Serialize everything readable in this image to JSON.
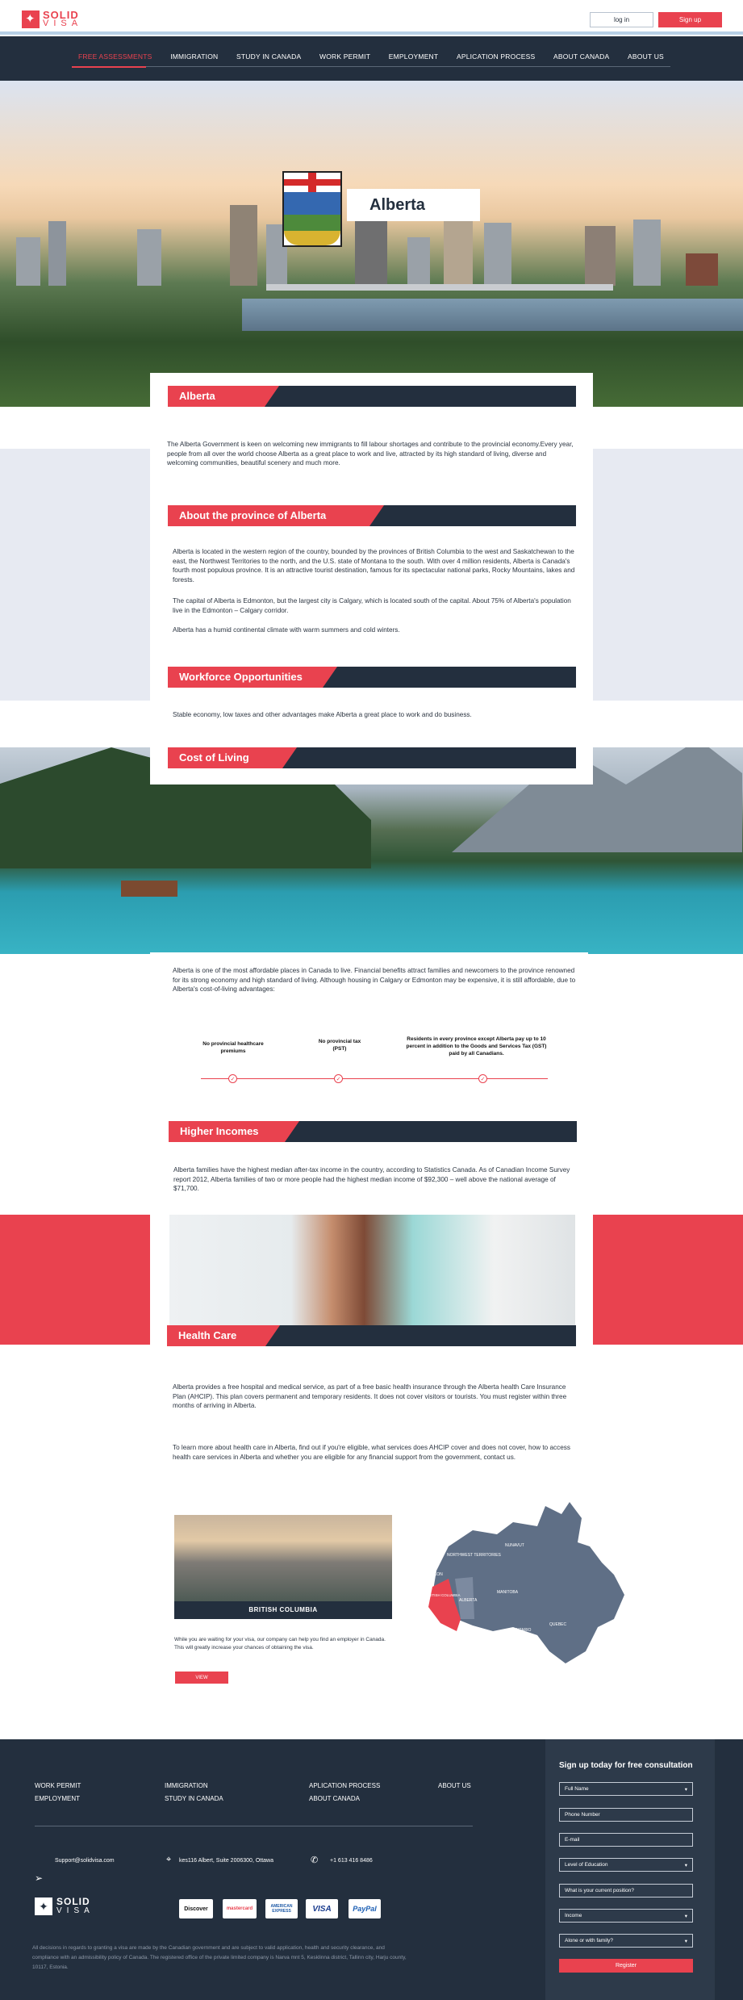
{
  "header": {
    "logo_top": "SOLID",
    "logo_bottom": "VISA",
    "login_label": "log in",
    "signup_label": "Sign up"
  },
  "nav": {
    "items": [
      {
        "label": "FREE ASSESSMENTS"
      },
      {
        "label": "IMMIGRATION"
      },
      {
        "label": "STUDY IN CANADA"
      },
      {
        "label": "WORK PERMIT"
      },
      {
        "label": "EMPLOYMENT"
      },
      {
        "label": "APLICATION PROCESS"
      },
      {
        "label": "ABOUT CANADA"
      },
      {
        "label": "ABOUT US"
      }
    ]
  },
  "hero": {
    "title": "Alberta"
  },
  "sections": {
    "alberta": {
      "title": "Alberta",
      "text": "The Alberta Government is keen on welcoming new immigrants to fill labour shortages and contribute to the provincial economy.Every year, people from all over the world choose Alberta as a great place to work and live, attracted by its high standard of living, diverse and welcoming communities, beautiful scenery and much more."
    },
    "about": {
      "title": "About the province of Alberta",
      "p1": "Alberta is located in the western region of the country, bounded by the provinces of British Columbia to the west and Saskatchewan to the east, the Northwest Territories to the north, and the U.S. state of Montana to the south. With over 4 million residents, Alberta is Canada's fourth most populous province. It is an attractive tourist destination, famous for its spectacular national parks, Rocky Mountains, lakes and forests.",
      "p2": "The capital of Alberta is Edmonton, but the largest city is Calgary, which is located south of the capital. About 75% of Alberta's population live in the Edmonton – Calgary corridor.",
      "p3": "Alberta has a humid continental climate with warm summers and cold winters."
    },
    "workforce": {
      "title": "Workforce Opportunities",
      "text": "Stable economy, low taxes and other advantages make Alberta a great place to work and do business."
    },
    "cost": {
      "title": "Cost of Living",
      "text": "Alberta is one of the most affordable places in Canada to live. Financial benefits attract families and newcomers to the province renowned for its strong economy and high standard of living. Although housing in Calgary or Edmonton may be expensive, it is still affordable, due to Alberta's cost-of-living advantages:",
      "advantages": [
        "No provincial healthcare premiums",
        "No provincial tax (PST)",
        "Residents in every province except Alberta pay up to 10 percent in addition to the Goods and Services Tax (GST) paid by all Canadians."
      ]
    },
    "income": {
      "title": "Higher Incomes",
      "text": "Alberta families have the highest median after-tax income in the country, according to Statistics Canada. As of Canadian Income Survey report 2012, Alberta families of two or more people had the highest median income of $92,300 – well above the national average of $71,700."
    },
    "health": {
      "title": "Health Care",
      "p1": "Alberta provides a free hospital and medical service, as part of a free basic health insurance through the Alberta health Care Insurance Plan (AHCIP). This plan covers permanent and temporary residents. It does not cover visitors or tourists. You must register within three months of arriving in Alberta.",
      "p2": "To learn more about health care in Alberta, find out if you're eligible, what services does AHCIP cover and does not cover, how to access health care services in Alberta and whether you are eligible for any financial support from the government, contact us."
    }
  },
  "province_card": {
    "name": "BRITISH COLUMBIA",
    "text": "While you are waiting for your visa, our company can help you find an employer in Canada. This will greatly increase your chances of obtaining the visa.",
    "button": "VIEW"
  },
  "map_labels": [
    "NUNAVUT",
    "NORTHWEST TERRITORIES",
    "YUKON",
    "BRITISH COLUMBIA",
    "ALBERTA",
    "MANITOBA",
    "ONTARIO",
    "QUEBEC"
  ],
  "footer": {
    "links": [
      "WORK PERMIT",
      "IMMIGRATION",
      "APLICATION PROCESS",
      "ABOUT US",
      "EMPLOYMENT",
      "STUDY IN CANADA",
      "ABOUT CANADA"
    ],
    "email": "Support@solidvisa.com",
    "address": "kes116 Albert, Suite 2006300, Ottawa",
    "phone": "+1 613 416 8486",
    "payments": [
      "Discover",
      "mastercard",
      "AMERICAN EXPRESS",
      "VISA",
      "PayPal"
    ],
    "disclaimer": "All decisions in regards to granting a visa are made by the Canadian government and are subject to valid application, health and security clearance, and compliance with an admissibility policy of Canada. The registered office of the private limited company is Narva mnt 5, Kesklinna district, Tallinn city, Harju county, 10117, Estonia.",
    "form": {
      "title": "Sign up today for free consultation",
      "fields": [
        "Full Name",
        "Phone Number",
        "E-mail",
        "Level of Education",
        "What is your current position?",
        "Income",
        "Alone or with family?"
      ],
      "button": "Register"
    }
  },
  "colors": {
    "accent": "#e9424f",
    "navy": "#232f3e",
    "grey_panel": "#e7eaf2"
  }
}
